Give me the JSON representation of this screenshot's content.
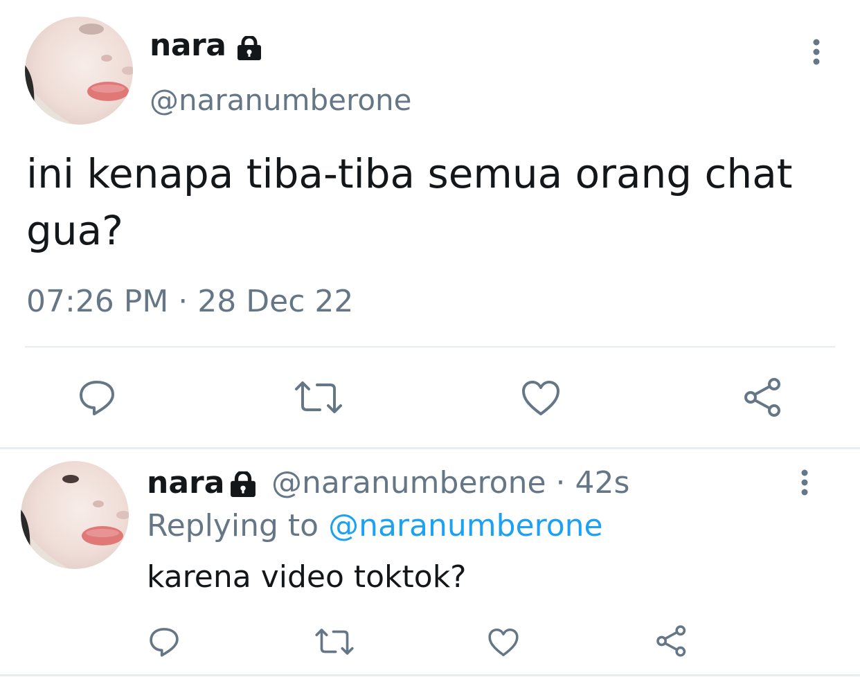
{
  "main_tweet": {
    "display_name": "nara",
    "handle": "@naranumberone",
    "text": "ini kenapa tiba-tiba semua orang chat gua?",
    "time": "07:26 PM",
    "separator": "·",
    "date": "28 Dec 22",
    "icons": {
      "lock": "lock-icon",
      "more": "more-vertical-icon",
      "reply": "reply-icon",
      "retweet": "retweet-icon",
      "like": "heart-icon",
      "share": "share-icon"
    }
  },
  "reply_tweet": {
    "display_name": "nara",
    "handle_time": "@naranumberone · 42s",
    "replying_prefix": "Replying to",
    "replying_to": "@naranumberone",
    "text": "karena video toktok?"
  },
  "colors": {
    "text": "#14171a",
    "secondary": "#657786",
    "link": "#1da1f2",
    "divider": "#e6ecf0"
  }
}
